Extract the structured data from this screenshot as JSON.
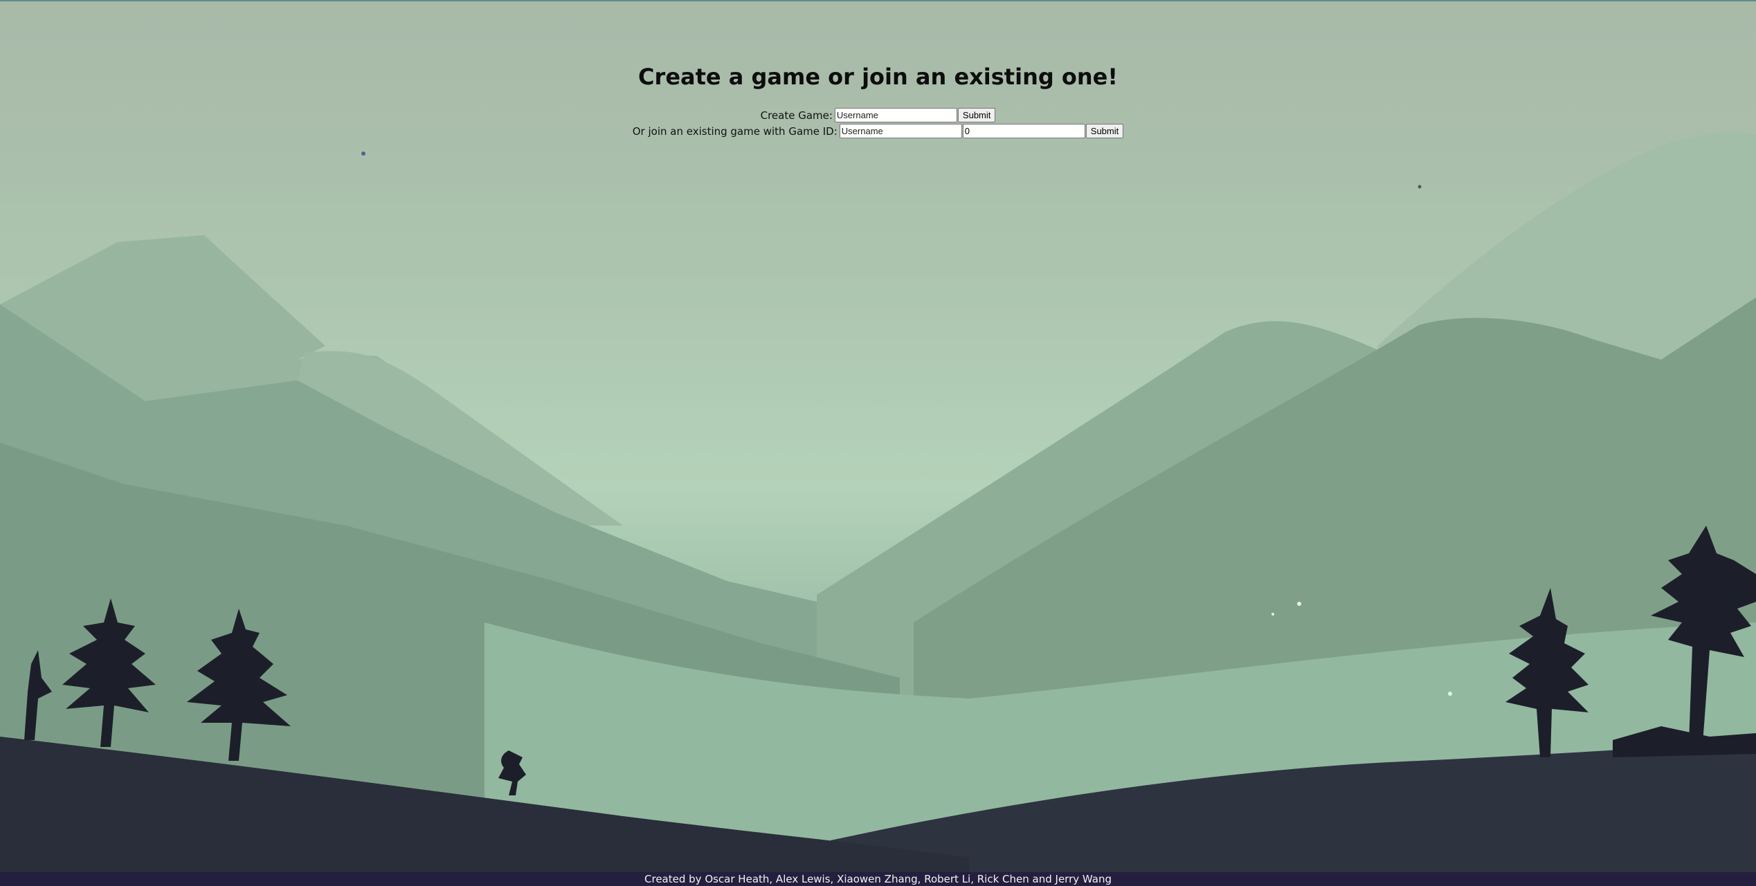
{
  "page": {
    "title": "Create a game or join an existing one!"
  },
  "create": {
    "label": "Create Game:",
    "username_placeholder": "Username",
    "submit_label": "Submit"
  },
  "join": {
    "label": "Or join an existing game with Game ID:",
    "username_placeholder": "Username",
    "game_id_value": "0",
    "submit_label": "Submit"
  },
  "footer": {
    "credits": "Created by Oscar Heath, Alex Lewis, Xiaowen Zhang, Robert Li, Rick Chen and Jerry Wang"
  },
  "colors": {
    "footer_bg": "#241f3e",
    "sky": "#b4d2b9",
    "foreground": "#2a2d3a"
  }
}
